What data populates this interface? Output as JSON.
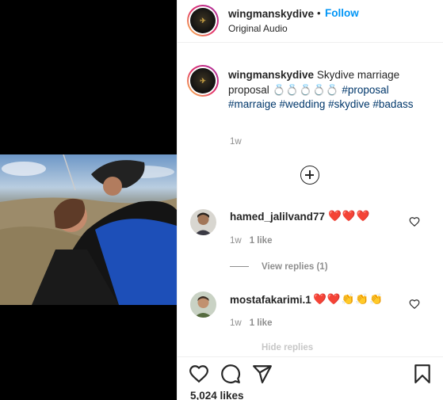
{
  "post": {
    "username": "wingmanskydive",
    "follow_label": "Follow",
    "dot": "•",
    "audio": "Original Audio"
  },
  "caption": {
    "username": "wingmanskydive",
    "text": "Skydive marriage proposal 💍💍💍💍💍",
    "hashtags": [
      "#proposal",
      "#marraige",
      "#wedding",
      "#skydive",
      "#badass"
    ],
    "time": "1w"
  },
  "comments": [
    {
      "username": "hamed_jalilvand77",
      "text": "❤️❤️❤️",
      "time": "1w",
      "likes": "1 like",
      "replies": "View replies (1)"
    },
    {
      "username": "mostafakarimi.1",
      "text": "❤️❤️👏👏👏",
      "time": "1w",
      "likes": "1 like",
      "replies": "Hide replies"
    }
  ],
  "footer": {
    "likes": "5,024 likes"
  },
  "icons": [
    "heart-icon",
    "comment-icon",
    "share-icon",
    "save-icon",
    "add-comment-icon"
  ],
  "colors": {
    "link": "#0095f6",
    "hashtag": "#00376b",
    "muted": "#8e8e8e",
    "heart": "#ed4956"
  }
}
